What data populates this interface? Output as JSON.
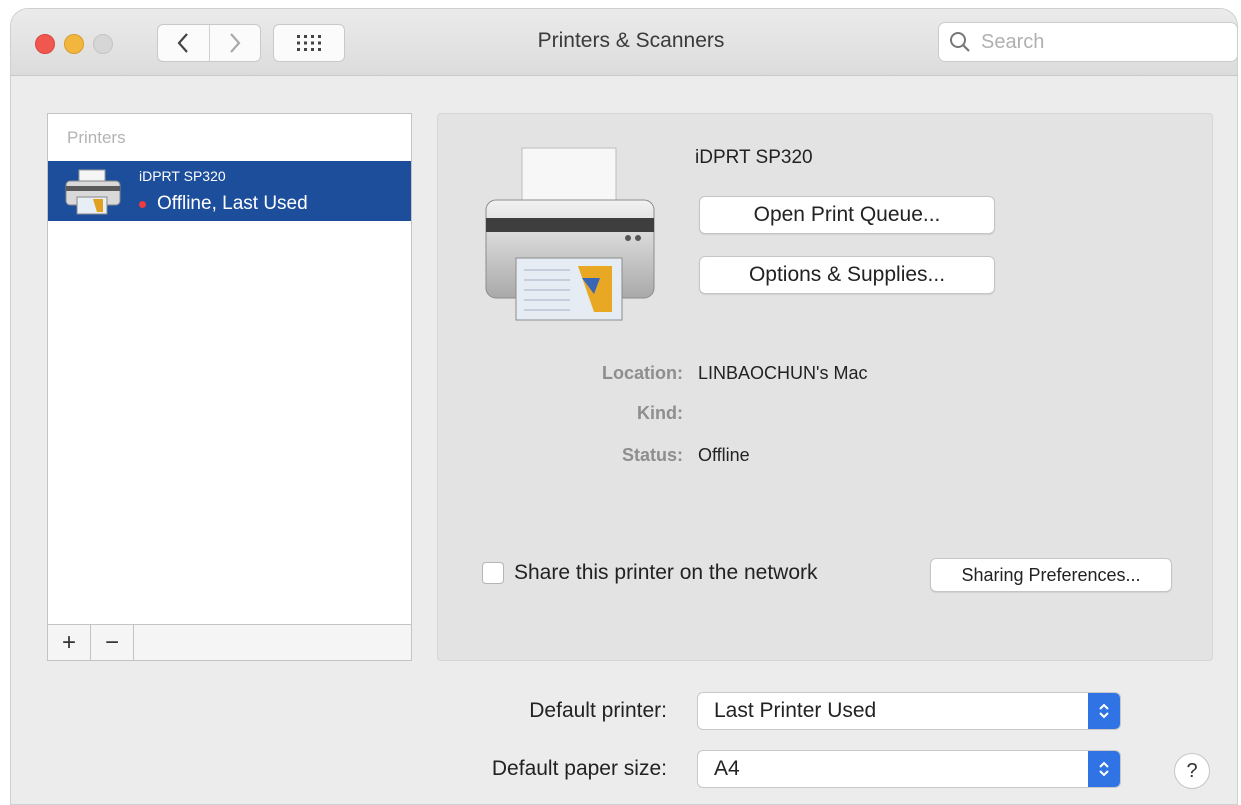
{
  "window": {
    "title": "Printers & Scanners"
  },
  "search": {
    "placeholder": "Search"
  },
  "sidebar": {
    "header": "Printers",
    "printers": [
      {
        "name": "iDPRT SP320",
        "status": "Offline, Last Used",
        "selected": true
      }
    ],
    "add_label": "+",
    "remove_label": "−"
  },
  "detail": {
    "printer_name": "iDPRT SP320",
    "open_queue_label": "Open Print Queue...",
    "options_label": "Options & Supplies...",
    "location_label": "Location:",
    "location_value": "LINBAOCHUN's Mac",
    "kind_label": "Kind:",
    "kind_value": "",
    "status_label": "Status:",
    "status_value": "Offline",
    "share_label": "Share this printer on the network",
    "share_checked": false,
    "sharing_prefs_label": "Sharing Preferences..."
  },
  "prefs": {
    "default_printer_label": "Default printer:",
    "default_printer_value": "Last Printer Used",
    "default_paper_label": "Default paper size:",
    "default_paper_value": "A4"
  },
  "help_label": "?",
  "colors": {
    "selection": "#1d4e9c",
    "offline_dot": "#ef3b3b",
    "select_accent": "#2f73e5"
  }
}
